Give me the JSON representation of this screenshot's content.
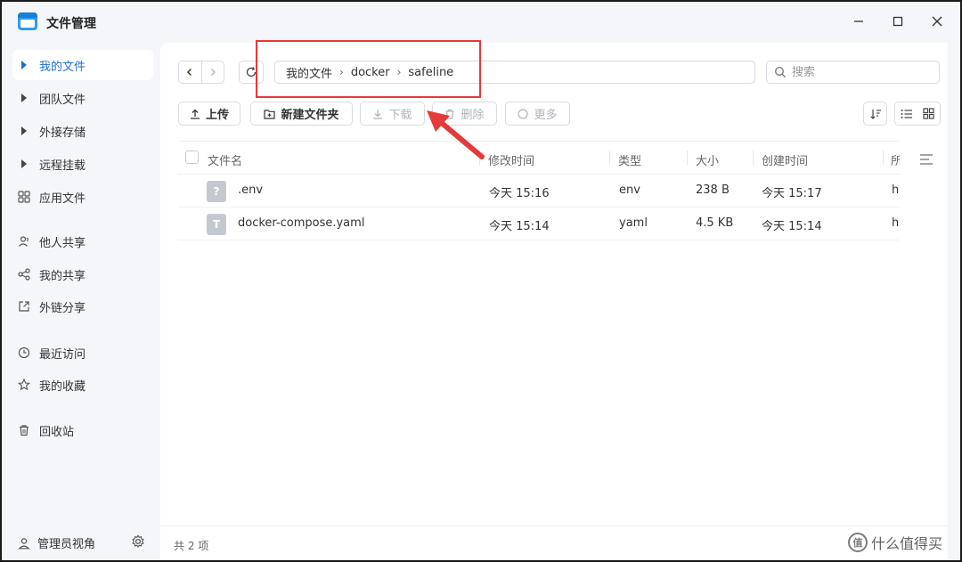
{
  "window": {
    "title": "文件管理",
    "minimize": "–",
    "maximize": "☐",
    "close": "✕"
  },
  "sidebar": {
    "items": [
      {
        "label": "我的文件",
        "icon": "caret-right-icon",
        "active": true
      },
      {
        "label": "团队文件",
        "icon": "caret-right-icon"
      },
      {
        "label": "外接存储",
        "icon": "caret-right-icon"
      },
      {
        "label": "远程挂载",
        "icon": "caret-right-icon"
      },
      {
        "label": "应用文件",
        "icon": "apps-grid-icon"
      },
      {
        "label": "他人共享",
        "icon": "users-icon"
      },
      {
        "label": "我的共享",
        "icon": "share-icon"
      },
      {
        "label": "外链分享",
        "icon": "external-link-icon"
      },
      {
        "label": "最近访问",
        "icon": "clock-icon"
      },
      {
        "label": "我的收藏",
        "icon": "star-icon"
      },
      {
        "label": "回收站",
        "icon": "trash-icon"
      }
    ],
    "footer": {
      "admin_label": "管理员视角",
      "settings_icon": "gear-icon"
    }
  },
  "navigation": {
    "back_icon": "‹",
    "forward_icon": "›",
    "breadcrumb": [
      "我的文件",
      "docker",
      "safeline"
    ],
    "separator": "›",
    "search_placeholder": "搜索"
  },
  "toolbar": {
    "upload": "上传",
    "new_folder": "新建文件夹",
    "download": "下载",
    "delete": "删除",
    "more": "更多"
  },
  "table": {
    "columns": [
      "文件名",
      "修改时间",
      "类型",
      "大小",
      "创建时间",
      "所"
    ],
    "rows": [
      {
        "name": ".env",
        "icon_glyph": "?",
        "modified": "今天 15:16",
        "type": "env",
        "size": "238 B",
        "created": "今天 15:17",
        "owner": "h"
      },
      {
        "name": "docker-compose.yaml",
        "icon_glyph": "T",
        "modified": "今天 15:14",
        "type": "yaml",
        "size": "4.5 KB",
        "created": "今天 15:14",
        "owner": "h"
      }
    ]
  },
  "status": {
    "count_text": "共 2 项"
  },
  "colors": {
    "accent": "#1f6fd1",
    "annotation": "#e5393a"
  },
  "watermark": {
    "text": "什么值得买",
    "logo": "值"
  }
}
